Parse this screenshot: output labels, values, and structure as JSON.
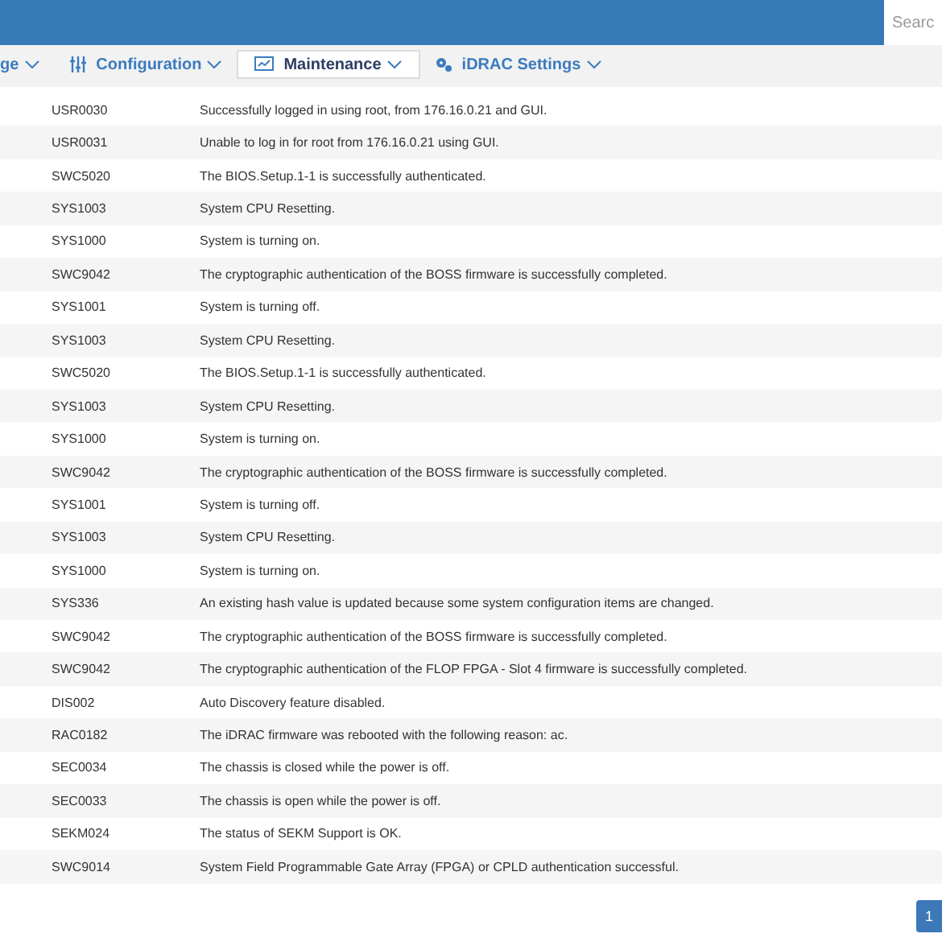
{
  "header": {
    "search": {
      "placeholder": "Searc"
    }
  },
  "nav": [
    {
      "label": "ge",
      "selected": false
    },
    {
      "label": "Configuration",
      "selected": false
    },
    {
      "label": "Maintenance",
      "selected": true
    },
    {
      "label": "iDRAC Settings",
      "selected": false
    }
  ],
  "log": [
    {
      "id": "USR0030",
      "message": "Successfully logged in using root, from 176.16.0.21 and GUI."
    },
    {
      "id": "USR0031",
      "message": "Unable to log in for root from 176.16.0.21 using GUI."
    },
    {
      "id": "SWC5020",
      "message": "The BIOS.Setup.1-1 is successfully authenticated."
    },
    {
      "id": "SYS1003",
      "message": "System CPU Resetting."
    },
    {
      "id": "SYS1000",
      "message": "System is turning on."
    },
    {
      "id": "SWC9042",
      "message": "The cryptographic authentication of the BOSS firmware is successfully completed."
    },
    {
      "id": "SYS1001",
      "message": "System is turning off."
    },
    {
      "id": "SYS1003",
      "message": "System CPU Resetting."
    },
    {
      "id": "SWC5020",
      "message": "The BIOS.Setup.1-1 is successfully authenticated."
    },
    {
      "id": "SYS1003",
      "message": "System CPU Resetting."
    },
    {
      "id": "SYS1000",
      "message": "System is turning on."
    },
    {
      "id": "SWC9042",
      "message": "The cryptographic authentication of the BOSS firmware is successfully completed."
    },
    {
      "id": "SYS1001",
      "message": "System is turning off."
    },
    {
      "id": "SYS1003",
      "message": "System CPU Resetting."
    },
    {
      "id": "SYS1000",
      "message": "System is turning on."
    },
    {
      "id": "SYS336",
      "message": "An existing hash value is updated because some system configuration items are changed."
    },
    {
      "id": "SWC9042",
      "message": "The cryptographic authentication of the BOSS firmware is successfully completed."
    },
    {
      "id": "SWC9042",
      "message": "The cryptographic authentication of the FLOP FPGA - Slot 4 firmware is successfully completed."
    },
    {
      "id": "DIS002",
      "message": "Auto Discovery feature disabled."
    },
    {
      "id": "RAC0182",
      "message": "The iDRAC firmware was rebooted with the following reason: ac."
    },
    {
      "id": "SEC0034",
      "message": "The chassis is closed while the power is off."
    },
    {
      "id": "SEC0033",
      "message": "The chassis is open while the power is off."
    },
    {
      "id": "SEKM024",
      "message": "The status of SEKM Support is OK."
    },
    {
      "id": "SWC9014",
      "message": "System Field Programmable Gate Array (FPGA) or CPLD authentication successful."
    }
  ],
  "pagination": [
    {
      "label": "1",
      "selected": true
    }
  ]
}
